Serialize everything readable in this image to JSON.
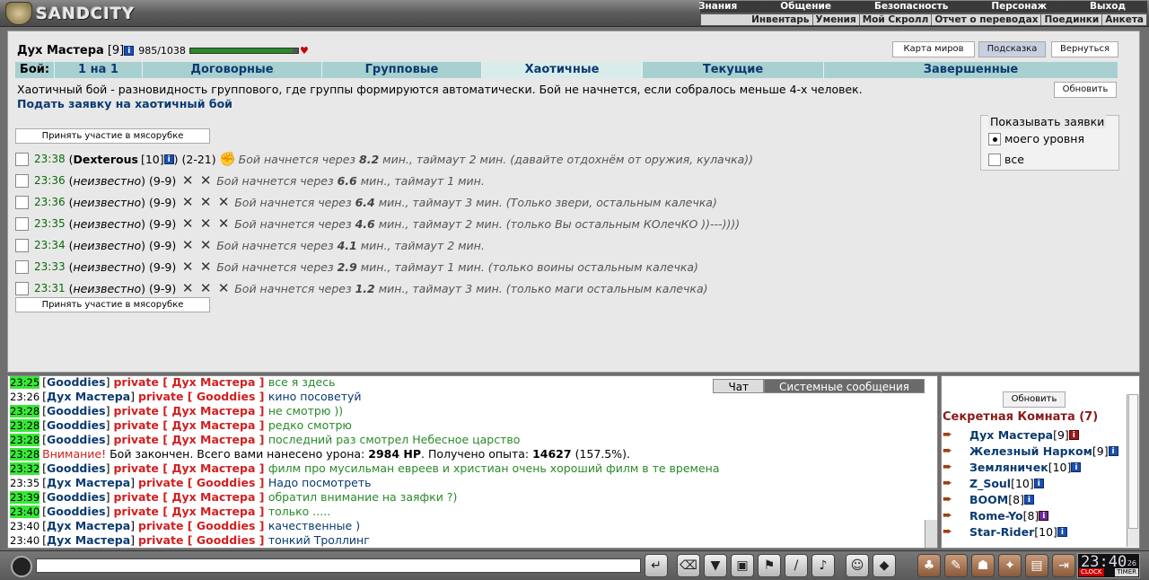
{
  "app": {
    "logo": "SANDCITY"
  },
  "topmenu": {
    "row1": [
      "Знания",
      "Общение",
      "Безопасность",
      "Персонаж",
      "Выход"
    ],
    "row2": [
      "Инвентарь",
      "Умения",
      "Мой Скролл",
      "Отчет о переводах",
      "Поединки",
      "Анкета"
    ]
  },
  "user": {
    "name": "Дух Мастера",
    "level": "[9]",
    "hp": "985/1038",
    "hp_fraction": 0.949
  },
  "buttons": {
    "map": "Карта миров",
    "hint": "Подсказка",
    "back": "Вернуться",
    "refresh": "Обновить"
  },
  "tabs": {
    "label": "Бой:",
    "items": [
      "1 на 1",
      "Договорные",
      "Групповые",
      "Хаотичные",
      "Текущие",
      "Завершенные"
    ],
    "selected": 3
  },
  "desc": "Хаотичный бой - разновидность группового, где группы формируются автоматически. Бой не начнется, если собралось меньше 4-х человек.",
  "apply_link": "Подать заявку на хаотичный бой",
  "join_button": "Принять участие в мясорубке",
  "filter": {
    "title": "Показывать заявки",
    "options": [
      "моего уровня",
      "все"
    ],
    "selected": 0
  },
  "bids": [
    {
      "time": "23:38",
      "who": "Dexterous",
      "level": "[10]",
      "range": "(2-21)",
      "text_pre": "Бой начнется через",
      "mins": "8.2",
      "text_post": "мин., таймаут 2 мин. (давайте отдохнём от оружия, кулачка))"
    },
    {
      "time": "23:36",
      "who": "неизвестно",
      "level": "",
      "range": "(9-9)",
      "text_pre": "Бой начнется через",
      "mins": "6.6",
      "text_post": "мин., таймаут 1 мин."
    },
    {
      "time": "23:36",
      "who": "неизвестно",
      "level": "",
      "range": "(9-9)",
      "text_pre": "Бой начнется через",
      "mins": "6.4",
      "text_post": "мин., таймаут 3 мин. (Только звери, остальным калечка)"
    },
    {
      "time": "23:35",
      "who": "неизвестно",
      "level": "",
      "range": "(9-9)",
      "text_pre": "Бой начнется через",
      "mins": "4.6",
      "text_post": "мин., таймаут 2 мин. (только Вы остальным КОлечКО ))---))))"
    },
    {
      "time": "23:34",
      "who": "неизвестно",
      "level": "",
      "range": "(9-9)",
      "text_pre": "Бой начнется через",
      "mins": "4.1",
      "text_post": "мин., таймаут 2 мин."
    },
    {
      "time": "23:33",
      "who": "неизвестно",
      "level": "",
      "range": "(9-9)",
      "text_pre": "Бой начнется через",
      "mins": "2.9",
      "text_post": "мин., таймаут 1 мин. (только воины остальным калечка)"
    },
    {
      "time": "23:31",
      "who": "неизвестно",
      "level": "",
      "range": "(9-9)",
      "text_pre": "Бой начнется через",
      "mins": "1.2",
      "text_post": "мин., таймаут 3 мин. (только маги остальным калечка)"
    }
  ],
  "chat_tabs": [
    "Чат",
    "Системные сообщения"
  ],
  "chat": [
    {
      "time": "23:25",
      "hl": true,
      "from": "Gooddies",
      "to": "Дух Мастера",
      "msg": "все я здесь",
      "color": "green"
    },
    {
      "time": "23:26",
      "hl": false,
      "from": "Дух Мастера",
      "to": "Gooddies",
      "msg": "кино посоветуй",
      "color": "blue"
    },
    {
      "time": "23:28",
      "hl": true,
      "from": "Gooddies",
      "to": "Дух Мастера",
      "msg": "не смотрю ))",
      "color": "green"
    },
    {
      "time": "23:28",
      "hl": true,
      "from": "Gooddies",
      "to": "Дух Мастера",
      "msg": "редко смотрю",
      "color": "green"
    },
    {
      "time": "23:28",
      "hl": true,
      "from": "Gooddies",
      "to": "Дух Мастера",
      "msg": "последний раз смотрел Небесное царство",
      "color": "green"
    },
    {
      "time": "23:32",
      "hl": true,
      "from": "Gooddies",
      "to": "Дух Мастера",
      "msg": "филм про мусильман евреев и христиан очень хороший филм в те времена",
      "color": "green"
    },
    {
      "time": "23:35",
      "hl": false,
      "from": "Дух Мастера",
      "to": "Gooddies",
      "msg": "Надо посмотреть",
      "color": "blue"
    },
    {
      "time": "23:39",
      "hl": true,
      "from": "Gooddies",
      "to": "Дух Мастера",
      "msg": "обратил внимание на заяфки ?)",
      "color": "green"
    },
    {
      "time": "23:40",
      "hl": true,
      "from": "Gooddies",
      "to": "Дух Мастера",
      "msg": "только .....",
      "color": "green"
    },
    {
      "time": "23:40",
      "hl": false,
      "from": "Дух Мастера",
      "to": "Gooddies",
      "msg": "качественные )",
      "color": "blue"
    },
    {
      "time": "23:40",
      "hl": false,
      "from": "Дух Мастера",
      "to": "Gooddies",
      "msg": "тонкий Троллинг",
      "color": "blue"
    }
  ],
  "chat_system": {
    "time": "23:28",
    "warn": "Внимание!",
    "pre": "Бой закончен. Всего вами нанесено урона:",
    "dmg": "2984 HP",
    "mid": ". Получено опыта:",
    "exp": "14627",
    "post": "(157.5%)."
  },
  "chat_private": "private",
  "room": {
    "refresh": "Обновить",
    "title": "Секретная Комната (7)",
    "members": [
      {
        "name": "Дух Мастера",
        "level": "[9]",
        "badge": "red"
      },
      {
        "name": "Железный Нарком",
        "level": "[9]",
        "badge": "blue"
      },
      {
        "name": "Земляничек",
        "level": "[10]",
        "badge": "blue"
      },
      {
        "name": "Z_Soul",
        "level": "[10]",
        "badge": "blue"
      },
      {
        "name": "BOOM",
        "level": "[8]",
        "badge": "blue"
      },
      {
        "name": "Rome-Yo",
        "level": "[8]",
        "badge": "purple"
      },
      {
        "name": "Star-Rider",
        "level": "[10]",
        "badge": "blue"
      }
    ]
  },
  "clock": {
    "time": "23:40",
    "seconds": "26",
    "label1": "CLOCK",
    "label2": "TIMER"
  },
  "icons": {
    "info": "i",
    "heart": "♥"
  }
}
